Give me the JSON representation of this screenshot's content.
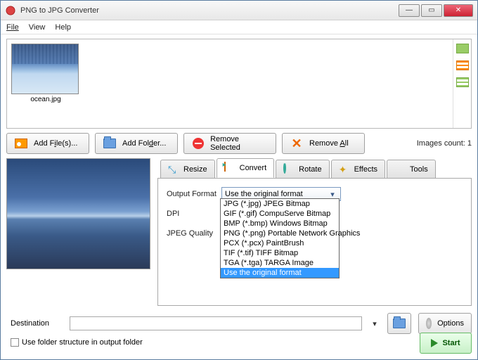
{
  "window": {
    "title": "PNG to JPG Converter"
  },
  "menu": {
    "file": "File",
    "view": "View",
    "help": "Help"
  },
  "thumbs": {
    "item0": {
      "label": "ocean.jpg"
    }
  },
  "toolbar": {
    "add_files": "Add File(s)...",
    "add_folder": "Add Folder...",
    "remove_selected": "Remove Selected",
    "remove_all": "Remove All",
    "count_label": "Images count: 1"
  },
  "tabs": {
    "resize": "Resize",
    "convert": "Convert",
    "rotate": "Rotate",
    "effects": "Effects",
    "tools": "Tools"
  },
  "convert": {
    "output_format_label": "Output Format",
    "dpi_label": "DPI",
    "jpeg_quality_label": "JPEG Quality",
    "combo_value": "Use the original format",
    "options": [
      "JPG (*.jpg) JPEG Bitmap",
      "GIF (*.gif) CompuServe Bitmap",
      "BMP (*.bmp) Windows Bitmap",
      "PNG (*.png) Portable Network Graphics",
      "PCX (*.pcx) PaintBrush",
      "TIF (*.tif) TIFF Bitmap",
      "TGA (*.tga) TARGA Image",
      "Use the original format"
    ]
  },
  "bottom": {
    "destination_label": "Destination",
    "folder_struct_label": "Use folder structure in output folder",
    "options_label": "Options",
    "start_label": "Start"
  }
}
